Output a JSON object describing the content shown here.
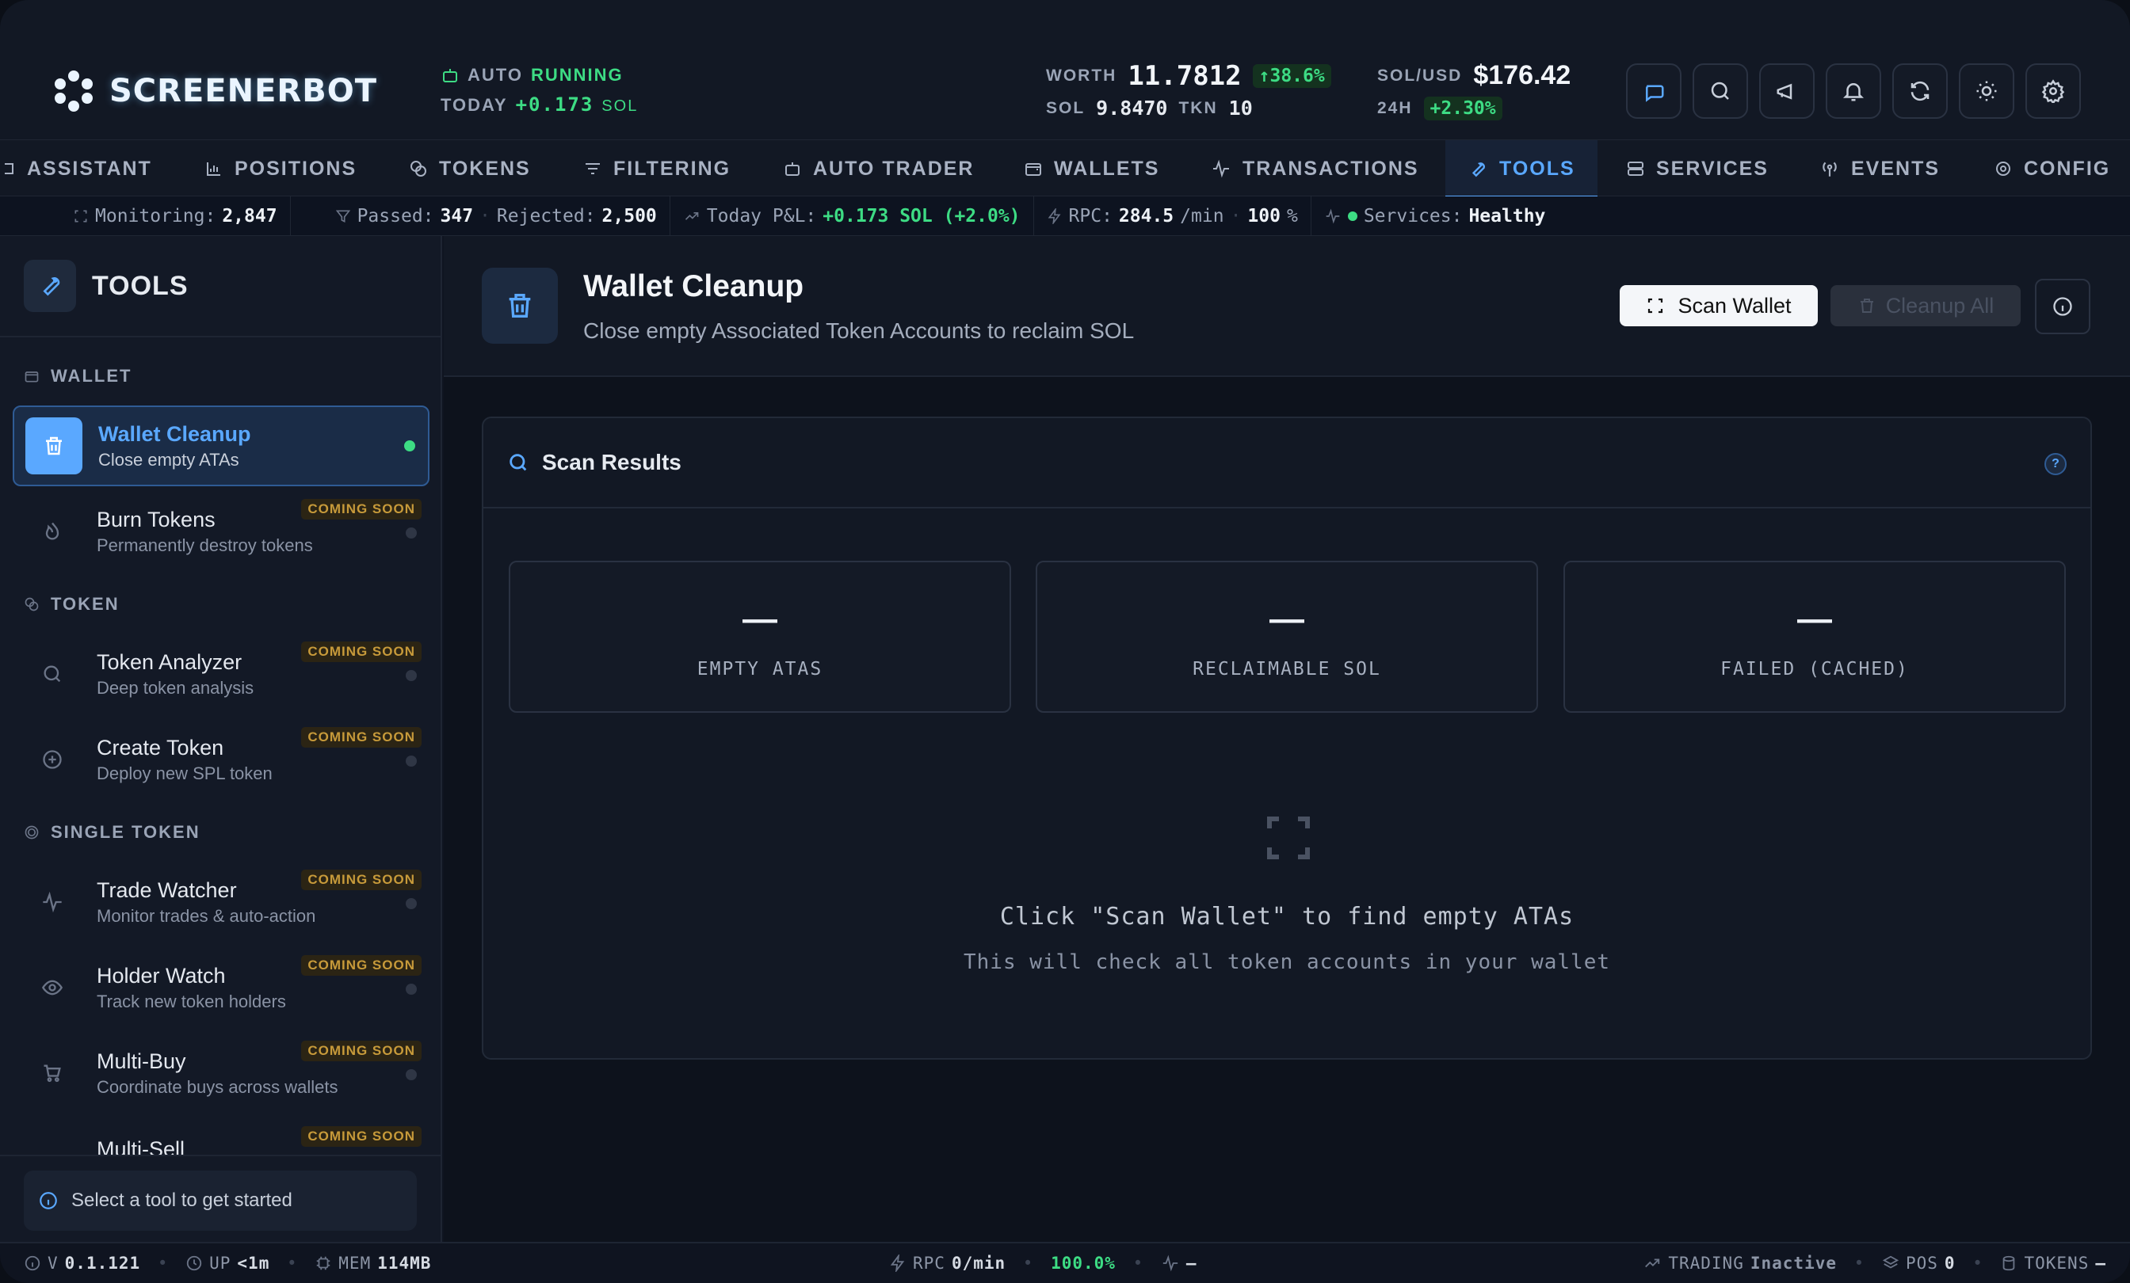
{
  "app": {
    "name": "SCREENERBOT"
  },
  "header": {
    "auto_label": "AUTO",
    "auto_status": "RUNNING",
    "today_label": "TODAY",
    "today_value": "+0.173",
    "today_unit": "SOL",
    "worth_label": "WORTH",
    "worth_value": "11.7812",
    "worth_change": "↑38.6%",
    "sol_label": "SOL",
    "sol_value": "9.8470",
    "tkn_label": "TKN",
    "tkn_value": "10",
    "solusd_label": "SOL/USD",
    "solusd_value": "$176.42",
    "h24_label": "24H",
    "h24_change": "+2.30%"
  },
  "nav": {
    "items": [
      {
        "label": "ASSISTANT",
        "icon": "bot-icon"
      },
      {
        "label": "POSITIONS",
        "icon": "chart-icon"
      },
      {
        "label": "TOKENS",
        "icon": "coins-icon"
      },
      {
        "label": "FILTERING",
        "icon": "filter-icon"
      },
      {
        "label": "AUTO TRADER",
        "icon": "robot-icon"
      },
      {
        "label": "WALLETS",
        "icon": "wallet-icon"
      },
      {
        "label": "TRANSACTIONS",
        "icon": "activity-icon"
      },
      {
        "label": "TOOLS",
        "icon": "wrench-icon"
      },
      {
        "label": "SERVICES",
        "icon": "server-icon"
      },
      {
        "label": "EVENTS",
        "icon": "broadcast-icon"
      },
      {
        "label": "CONFIG",
        "icon": "gear-icon"
      }
    ],
    "active": "TOOLS"
  },
  "ticker": {
    "monitoring_label": "Monitoring:",
    "monitoring_value": "2,847",
    "passed_label": "Passed:",
    "passed_value": "347",
    "rejected_label": "Rejected:",
    "rejected_value": "2,500",
    "pnl_label": "Today P&L:",
    "pnl_value": "+0.173 SOL (+2.0%)",
    "rpc_label": "RPC:",
    "rpc_value": "284.5",
    "rpc_unit": "/min",
    "rpc_pct": "100",
    "rpc_pct_unit": "%",
    "services_label": "Services:",
    "services_value": "Healthy"
  },
  "sidebar": {
    "title": "TOOLS",
    "sections": [
      {
        "label": "WALLET"
      },
      {
        "label": "TOKEN"
      },
      {
        "label": "SINGLE TOKEN"
      }
    ],
    "items": [
      {
        "title": "Wallet Cleanup",
        "sub": "Close empty ATAs",
        "badge": ""
      },
      {
        "title": "Burn Tokens",
        "sub": "Permanently destroy tokens",
        "badge": "COMING SOON"
      },
      {
        "title": "Token Analyzer",
        "sub": "Deep token analysis",
        "badge": "COMING SOON"
      },
      {
        "title": "Create Token",
        "sub": "Deploy new SPL token",
        "badge": "COMING SOON"
      },
      {
        "title": "Trade Watcher",
        "sub": "Monitor trades & auto-action",
        "badge": "COMING SOON"
      },
      {
        "title": "Holder Watch",
        "sub": "Track new token holders",
        "badge": "COMING SOON"
      },
      {
        "title": "Multi-Buy",
        "sub": "Coordinate buys across wallets",
        "badge": "COMING SOON"
      },
      {
        "title": "Multi-Sell",
        "sub": "",
        "badge": "COMING SOON"
      }
    ],
    "hint": "Select a tool to get started"
  },
  "main": {
    "title": "Wallet Cleanup",
    "subtitle": "Close empty Associated Token Accounts to reclaim SOL",
    "scan_button": "Scan Wallet",
    "cleanup_button": "Cleanup All",
    "panel_title": "Scan Results",
    "cards": [
      {
        "value": "—",
        "label": "EMPTY ATAS"
      },
      {
        "value": "—",
        "label": "RECLAIMABLE SOL"
      },
      {
        "value": "—",
        "label": "FAILED (CACHED)"
      }
    ],
    "empty_title": "Click \"Scan Wallet\" to find empty ATAs",
    "empty_sub": "This will check all token accounts in your wallet"
  },
  "statusbar": {
    "version_label": "V",
    "version": "0.1.121",
    "up_label": "UP",
    "up_value": "<1m",
    "mem_label": "MEM",
    "mem_value": "114MB",
    "rpc_label": "RPC",
    "rpc_value": "0/min",
    "rpc_pct": "100.0%",
    "activity_value": "—",
    "trading_label": "TRADING",
    "trading_value": "Inactive",
    "pos_label": "POS",
    "pos_value": "0",
    "tokens_label": "TOKENS",
    "tokens_value": "—"
  },
  "colors": {
    "accent": "#5aa8ff",
    "green": "#3ddc84",
    "amber": "#c79a3a"
  }
}
